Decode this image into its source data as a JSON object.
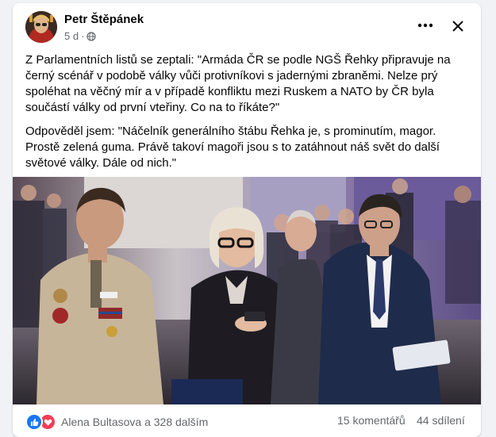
{
  "post": {
    "author": "Petr Štěpánek",
    "time": "5 d",
    "separator": "·",
    "paragraph1": "Z Parlamentních listů se zeptali: \"Armáda ČR se podle NGŠ Řehky připravuje na černý scénář v podobě války vůči protivníkovi s jadernými zbraněmi. Nelze prý spoléhat na věčný mír a v případě konfliktu mezi Ruskem a NATO by ČR byla součástí války od první vteřiny. Co na to říkáte?\"",
    "paragraph2": "Odpověděl jsem: \"Náčelník generálního štábu Řehka je, s prominutím, magor. Prostě zelená guma. Právě takoví magoři jsou s to zatáhnout náš svět do další světové války. Dále od nich.\""
  },
  "footer": {
    "reactions_text": "Alena Bultasova a 328 dalším",
    "comments": "15 komentářů",
    "shares": "44 sdílení"
  },
  "icons": {
    "more": "more-horizontal-icon",
    "close": "close-icon",
    "audience": "globe-icon",
    "like": "like-icon",
    "love": "love-icon"
  },
  "colors": {
    "like": "#1877f2",
    "love": "#f33e58",
    "secondary_text": "#65676b"
  }
}
